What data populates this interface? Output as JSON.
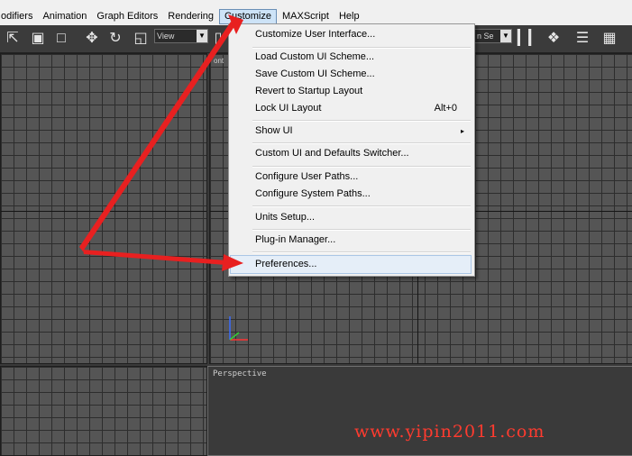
{
  "menubar": {
    "items": [
      {
        "label": "odifiers"
      },
      {
        "label": "Animation"
      },
      {
        "label": "Graph Editors"
      },
      {
        "label": "Rendering"
      },
      {
        "label": "Customize",
        "active": true
      },
      {
        "label": "MAXScript"
      },
      {
        "label": "Help"
      }
    ]
  },
  "toolbar": {
    "view_select": "View",
    "selection_set": "n Se",
    "icons": [
      "select-arrow-icon",
      "select-region-icon",
      "lasso-icon",
      "move-icon",
      "rotate-icon",
      "scale-icon",
      "mirror-icon",
      "align-icon",
      "layers-icon",
      "graphite-icon"
    ]
  },
  "customize_menu": {
    "items": [
      {
        "label": "Customize User Interface..."
      },
      {
        "label": "Load Custom UI Scheme..."
      },
      {
        "label": "Save Custom UI Scheme..."
      },
      {
        "label": "Revert to Startup Layout"
      },
      {
        "label": "Lock UI Layout",
        "shortcut": "Alt+0"
      },
      {
        "label": "Show UI",
        "submenu": "▸"
      },
      {
        "label": "Custom UI and Defaults Switcher..."
      },
      {
        "label": "Configure User Paths..."
      },
      {
        "label": "Configure System Paths..."
      },
      {
        "label": "Units Setup..."
      },
      {
        "label": "Plug-in Manager..."
      },
      {
        "label": "Preferences...",
        "highlighted": true
      }
    ]
  },
  "viewports": {
    "top_right_label": "ont",
    "bottom_right_label": "Perspective"
  },
  "watermark": "www.yipin2011.com",
  "colors": {
    "menu_highlight": "#cde3f7",
    "arrow": "#ee2222",
    "watermark": "#ff3b2f"
  }
}
